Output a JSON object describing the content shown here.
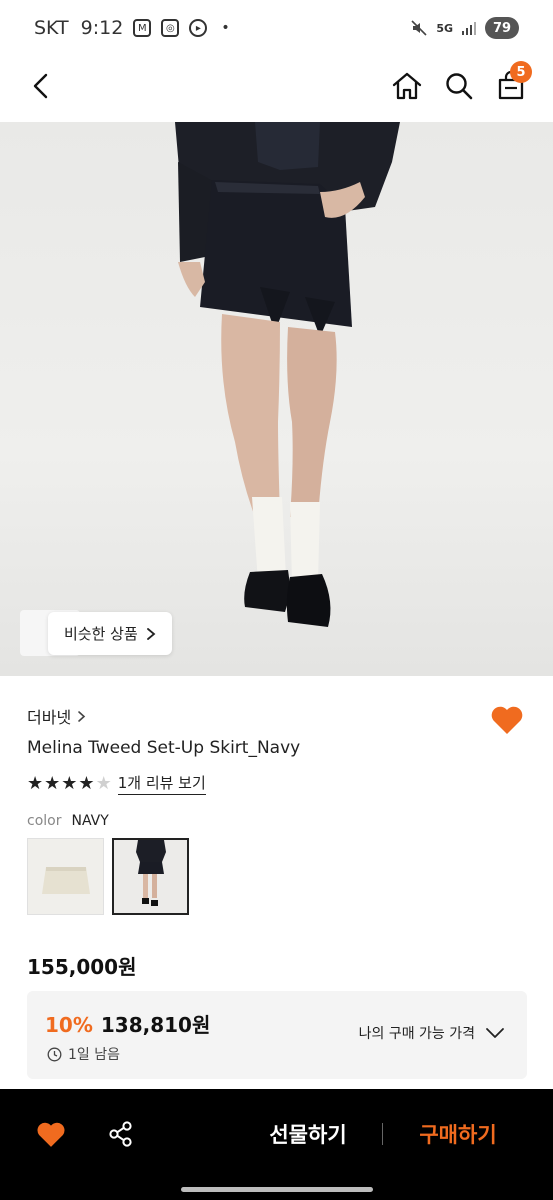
{
  "status_bar": {
    "carrier": "SKT",
    "time": "9:12",
    "network": "5G",
    "battery": "79"
  },
  "nav": {
    "cart_count": "5"
  },
  "image": {
    "similar_label": "비슷한 상품"
  },
  "product": {
    "brand": "더바넷",
    "name": "Melina Tweed Set-Up Skirt_Navy",
    "rating": 4,
    "rating_max": 5,
    "review_link": "1개 리뷰 보기",
    "color_label": "color",
    "color_value": "NAVY",
    "swatches": [
      "ivory-swatch",
      "navy-swatch"
    ],
    "price": "155,000원"
  },
  "discount": {
    "rate": "10%",
    "price": "138,810원",
    "timer": "1일 남음",
    "my_price_label": "나의 구매 가능 가격"
  },
  "bottom_bar": {
    "gift_label": "선물하기",
    "buy_label": "구매하기"
  },
  "colors": {
    "accent": "#f06b1f",
    "bottom_bar_bg": "#000000",
    "price_box_bg": "#f4f4f4"
  }
}
